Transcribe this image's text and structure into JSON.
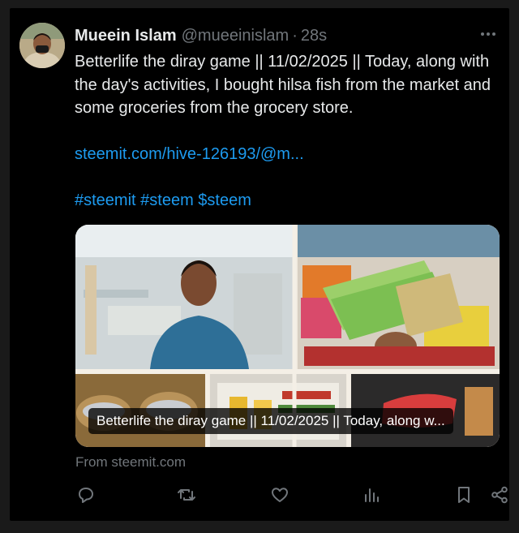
{
  "post": {
    "author_name": "Muеein Islam",
    "handle": "@mueeinislam",
    "separator": "·",
    "time": "28s",
    "text": "Betterlife the diray game || 11/02/2025 || Today, along with the day's activities, I bought hilsa fish from the market and some groceries from the grocery store.",
    "link": "steemit.com/hive-126193/@m...",
    "hashtags": "#steemit #steem $steem",
    "media_caption": "Betterlife the diray game || 11/02/2025 || Today, along w...",
    "source": "From steemit.com"
  },
  "icons": {
    "more": "more-dots-icon",
    "reply": "reply-icon",
    "repost": "repost-icon",
    "like": "like-icon",
    "views": "views-icon",
    "bookmark": "bookmark-icon",
    "share": "share-icon"
  },
  "colors": {
    "background": "#000000",
    "text": "#e7e9ea",
    "muted": "#71767b",
    "link": "#1d9bf0"
  }
}
